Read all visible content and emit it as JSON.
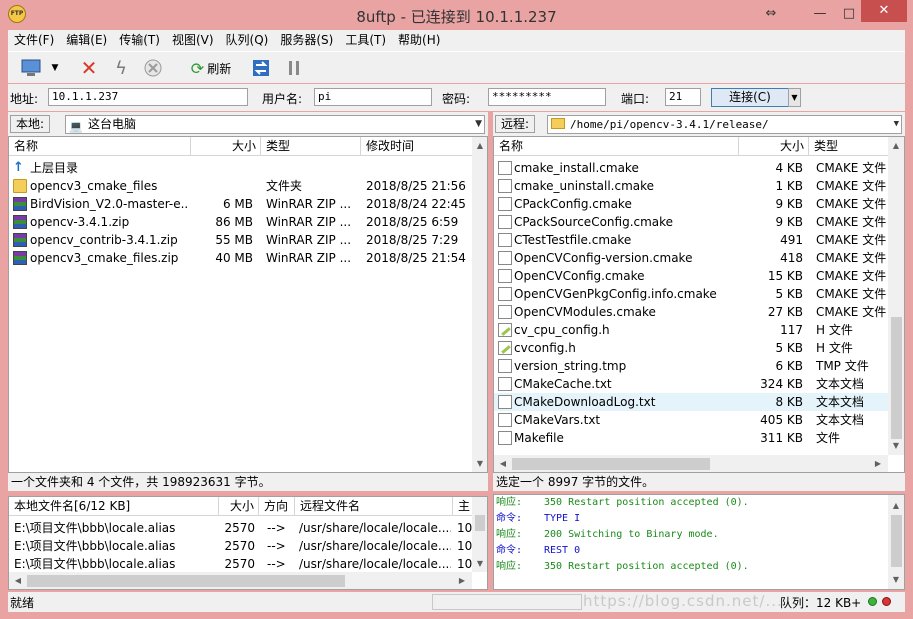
{
  "window": {
    "title": "8uftp - 已连接到 10.1.1.237",
    "icon_text": "FTP",
    "restore_glyph": "⇔",
    "minimize_glyph": "—",
    "maximize_glyph": "□",
    "close_glyph": "✕"
  },
  "menu": [
    "文件(F)",
    "编辑(E)",
    "传输(T)",
    "视图(V)",
    "队列(Q)",
    "服务器(S)",
    "工具(T)",
    "帮助(H)"
  ],
  "toolbar": {
    "refresh_label": "刷新"
  },
  "connection": {
    "address_label": "地址:",
    "address_value": "10.1.1.237",
    "user_label": "用户名:",
    "user_value": "pi",
    "password_label": "密码:",
    "password_value": "*********",
    "port_label": "端口:",
    "port_value": "21",
    "connect_label": "连接(C)"
  },
  "local": {
    "path_label": "本地:",
    "path_value": "这台电脑",
    "columns": [
      "名称",
      "大小",
      "类型",
      "修改时间"
    ],
    "files": [
      {
        "icon": "up",
        "name": "上层目录",
        "size": "",
        "type": "",
        "modified": ""
      },
      {
        "icon": "folder",
        "name": "opencv3_cmake_files",
        "size": "",
        "type": "文件夹",
        "modified": "2018/8/25 21:56"
      },
      {
        "icon": "rar",
        "name": "BirdVision_V2.0-master-e...",
        "size": "6 MB",
        "type": "WinRAR ZIP ...",
        "modified": "2018/8/24 22:45"
      },
      {
        "icon": "rar",
        "name": "opencv-3.4.1.zip",
        "size": "86 MB",
        "type": "WinRAR ZIP ...",
        "modified": "2018/8/25 6:59"
      },
      {
        "icon": "rar",
        "name": "opencv_contrib-3.4.1.zip",
        "size": "55 MB",
        "type": "WinRAR ZIP ...",
        "modified": "2018/8/25 7:29"
      },
      {
        "icon": "rar",
        "name": "opencv3_cmake_files.zip",
        "size": "40 MB",
        "type": "WinRAR ZIP ...",
        "modified": "2018/8/25 21:54"
      }
    ],
    "status": "一个文件夹和 4 个文件，共 198923631 字节。"
  },
  "remote": {
    "path_label": "远程:",
    "path_value": "/home/pi/opencv-3.4.1/release/",
    "columns": [
      "名称",
      "大小",
      "类型"
    ],
    "files": [
      {
        "icon": "doc",
        "name": "cmake_install.cmake",
        "size": "4 KB",
        "type": "CMAKE 文件"
      },
      {
        "icon": "doc",
        "name": "cmake_uninstall.cmake",
        "size": "1 KB",
        "type": "CMAKE 文件"
      },
      {
        "icon": "doc",
        "name": "CPackConfig.cmake",
        "size": "9 KB",
        "type": "CMAKE 文件"
      },
      {
        "icon": "doc",
        "name": "CPackSourceConfig.cmake",
        "size": "9 KB",
        "type": "CMAKE 文件"
      },
      {
        "icon": "doc",
        "name": "CTestTestfile.cmake",
        "size": "491",
        "type": "CMAKE 文件"
      },
      {
        "icon": "doc",
        "name": "OpenCVConfig-version.cmake",
        "size": "418",
        "type": "CMAKE 文件"
      },
      {
        "icon": "doc",
        "name": "OpenCVConfig.cmake",
        "size": "15 KB",
        "type": "CMAKE 文件"
      },
      {
        "icon": "doc",
        "name": "OpenCVGenPkgConfig.info.cmake",
        "size": "5 KB",
        "type": "CMAKE 文件"
      },
      {
        "icon": "doc",
        "name": "OpenCVModules.cmake",
        "size": "27 KB",
        "type": "CMAKE 文件"
      },
      {
        "icon": "hfile",
        "name": "cv_cpu_config.h",
        "size": "117",
        "type": "H 文件"
      },
      {
        "icon": "hfile",
        "name": "cvconfig.h",
        "size": "5 KB",
        "type": "H 文件"
      },
      {
        "icon": "doc",
        "name": "version_string.tmp",
        "size": "6 KB",
        "type": "TMP 文件"
      },
      {
        "icon": "doc",
        "name": "CMakeCache.txt",
        "size": "324 KB",
        "type": "文本文档"
      },
      {
        "icon": "doc",
        "name": "CMakeDownloadLog.txt",
        "size": "8 KB",
        "type": "文本文档",
        "selected": true
      },
      {
        "icon": "doc",
        "name": "CMakeVars.txt",
        "size": "405 KB",
        "type": "文本文档"
      },
      {
        "icon": "doc",
        "name": "Makefile",
        "size": "311 KB",
        "type": "文件"
      }
    ],
    "status": "选定一个 8997 字节的文件。"
  },
  "queue": {
    "columns": [
      "本地文件名[6/12 KB]",
      "大小",
      "方向",
      "远程文件名",
      "主"
    ],
    "rows": [
      {
        "local": "E:\\项目文件\\bbb\\locale.alias",
        "size": "2570",
        "dir": "-->",
        "remote": "/usr/share/locale/locale....",
        "host": "10."
      },
      {
        "local": "E:\\项目文件\\bbb\\locale.alias",
        "size": "2570",
        "dir": "-->",
        "remote": "/usr/share/locale/locale....",
        "host": "10."
      },
      {
        "local": "E:\\项目文件\\bbb\\locale.alias",
        "size": "2570",
        "dir": "-->",
        "remote": "/usr/share/locale/locale....",
        "host": "10."
      }
    ]
  },
  "log": [
    {
      "kind": "resp",
      "label": "响应:",
      "text": "350 Restart position accepted (0)."
    },
    {
      "kind": "cmd",
      "label": "命令:",
      "text": "TYPE I"
    },
    {
      "kind": "resp",
      "label": "响应:",
      "text": "200 Switching to Binary mode."
    },
    {
      "kind": "cmd",
      "label": "命令:",
      "text": "REST 0"
    },
    {
      "kind": "resp",
      "label": "响应:",
      "text": "350 Restart position accepted (0)."
    }
  ],
  "statusbar": {
    "text": "就绪",
    "queue": "队列：12 KB+",
    "watermark": "https://blog.csdn.net/..."
  },
  "colors": {
    "titlebar": "#e9a3a3",
    "close": "#c7504f",
    "selection": "#e5f3fb"
  }
}
